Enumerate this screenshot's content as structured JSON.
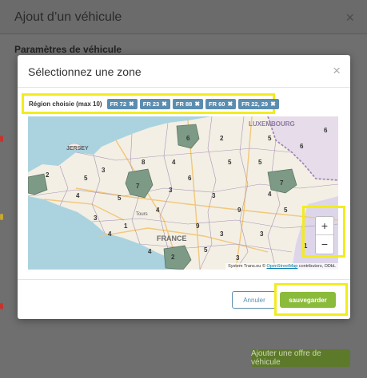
{
  "background": {
    "title": "Ajout d’un véhicule",
    "close_glyph": "×",
    "section_title": "Paramètres de véhicule",
    "footer_button": "Ajouter une offre de véhicule"
  },
  "dialog": {
    "title": "Sélectionnez une zone",
    "close_glyph": "×",
    "region_label": "Région choisie (max 10)",
    "tags": [
      "FR 72",
      "FR 23",
      "FR 88",
      "FR 60",
      "FR 22, 29"
    ],
    "tag_remove_glyph": "✖",
    "map": {
      "labels": {
        "jersey": "JERSEY",
        "france": "FRANCE",
        "luxembourg": "LUXEMBOURG",
        "tours": "Tours"
      },
      "attribution_prefix": "System Trans.eu ©",
      "attribution_link": "OpenStreetMap",
      "attribution_suffix": "contributors, ODbL",
      "zoom_in": "+",
      "zoom_out": "−",
      "department_numbers": [
        "6",
        "2",
        "7",
        "3",
        "5",
        "5",
        "8",
        "3",
        "4",
        "7",
        "9",
        "3",
        "4",
        "5",
        "9",
        "4",
        "1",
        "3",
        "6",
        "5",
        "3",
        "3",
        "2",
        "4",
        "4",
        "5",
        "3",
        "2",
        "5",
        "6",
        "4",
        "1",
        "6",
        "5"
      ]
    },
    "cancel_label": "Annuler",
    "save_label": "sauvegarder"
  },
  "colors": {
    "tag": "#5b8db0",
    "save": "#8bbb3a",
    "highlight": "#f2ec1f",
    "selected_region": "#7d9a87"
  }
}
